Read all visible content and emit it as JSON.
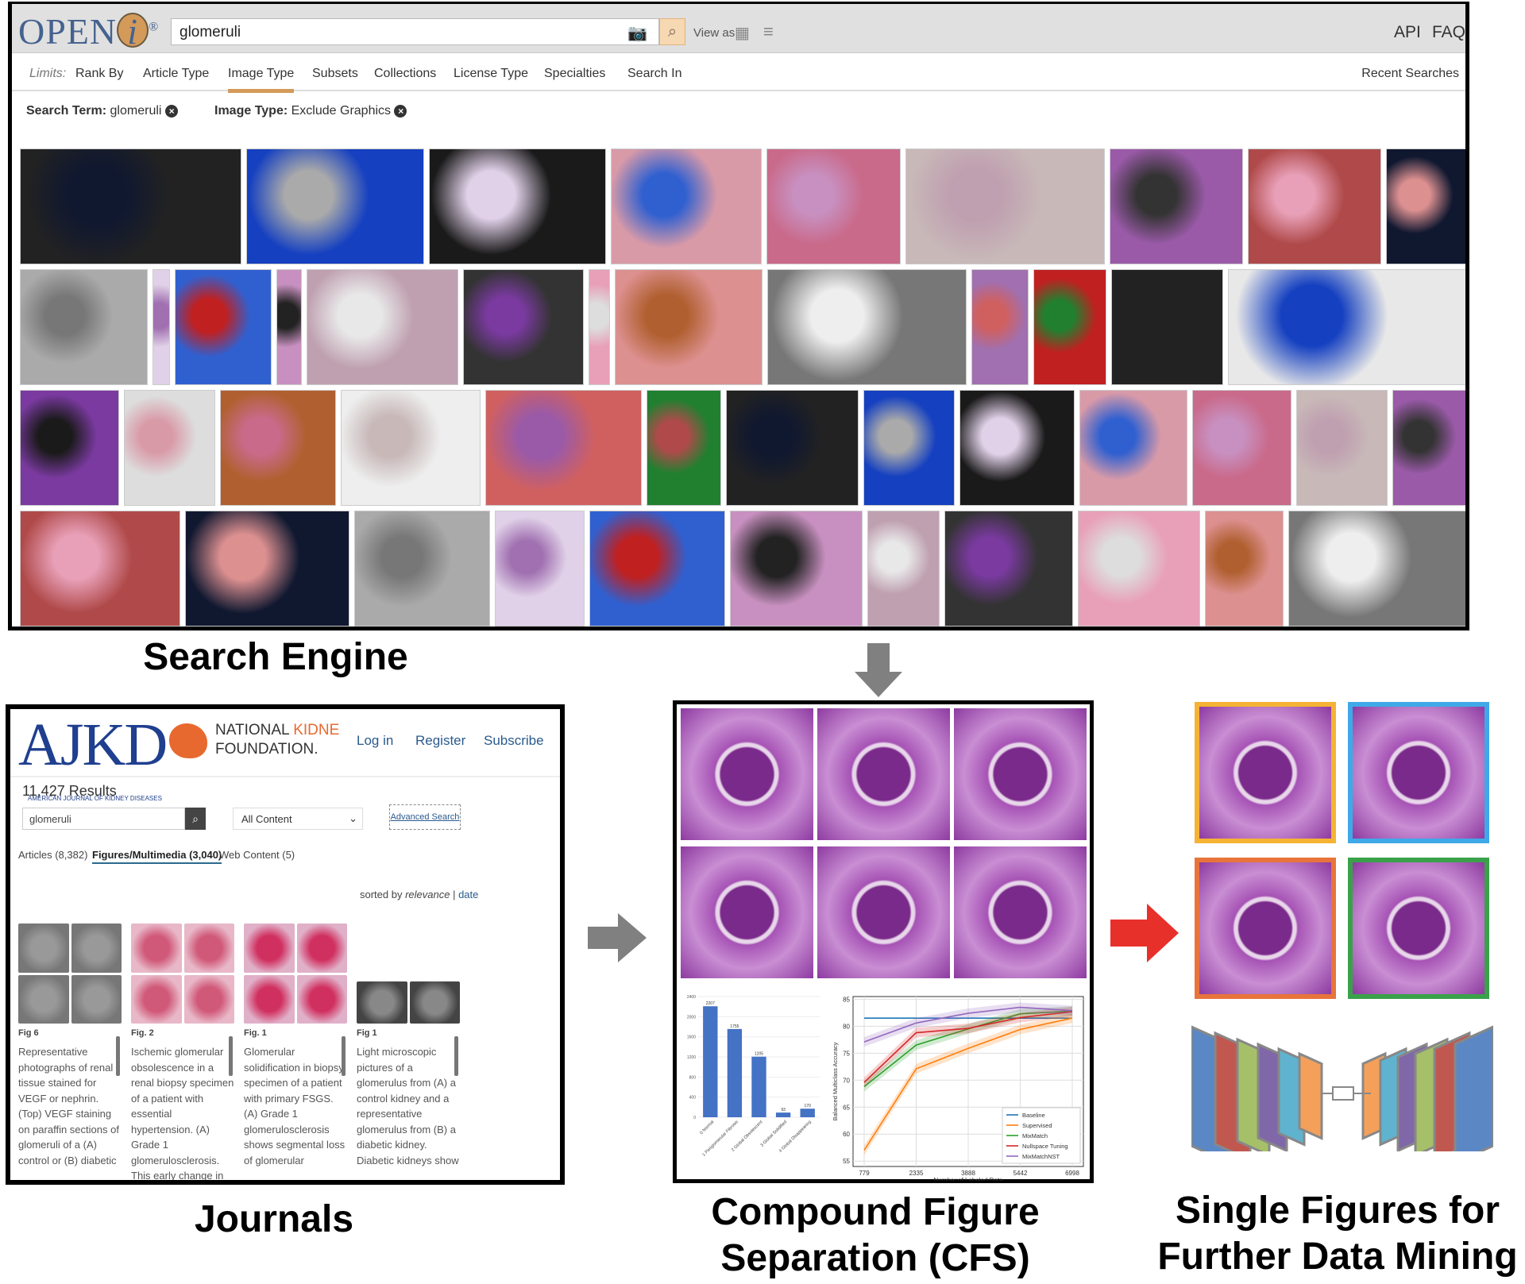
{
  "search_engine": {
    "logo": "OPENi",
    "logo_mark": "®",
    "search_value": "glomeruli",
    "camera_icon": "camera-icon",
    "search_icon": "search-icon",
    "view_as_label": "View as",
    "api_link": "API",
    "faq_link": "FAQ",
    "limits_label": "Limits:",
    "nav": [
      "Rank By",
      "Article Type",
      "Image Type",
      "Subsets",
      "Collections",
      "License Type",
      "Specialties",
      "Search In"
    ],
    "active_nav": "Image Type",
    "recent_searches": "Recent Searches",
    "filters": [
      {
        "key": "Search Term:",
        "value": "glomeruli"
      },
      {
        "key": "Image Type:",
        "value": "Exclude Graphics"
      }
    ],
    "accent_color": "#d49a5a",
    "thumbnail_colors": [
      "#222",
      "#1540c0",
      "#1a1a1a",
      "#d99aa8",
      "#c96a8a",
      "#c8b8b8",
      "#9a5aa8",
      "#b04a4a",
      "#101830",
      "#aaa",
      "#e0d0e8",
      "#3060d0",
      "#c890c0",
      "#bfa0b0",
      "#333",
      "#e8a0b8",
      "#dd9090",
      "#777",
      "#a070b0",
      "#c02020",
      "#222",
      "#e8e8e8",
      "#7a3aa0",
      "#ddd",
      "#b06030",
      "#eee",
      "#d06060",
      "#208030"
    ]
  },
  "labels": {
    "search_engine": "Search Engine",
    "journals": "Journals",
    "cfs_line1": "Compound Figure",
    "cfs_line2": "Separation (CFS)",
    "single_line1": "Single Figures for",
    "single_line2": "Further Data Mining"
  },
  "journal": {
    "logo": "AJKD",
    "logo_sub": "AMERICAN JOURNAL OF KIDNEY DISEASES",
    "nkf_line1a": "NATIONAL ",
    "nkf_line1b": "KIDNE",
    "nkf_line2": "FOUNDATION.",
    "links": [
      "Log in",
      "Register",
      "Subscribe"
    ],
    "results": "11,427 Results",
    "search_value": "glomeruli",
    "content_select": "All Content",
    "advanced_search": "Advanced Search",
    "tabs": [
      "Articles (8,382)",
      "Figures/Multimedia (3,040)",
      "Web Content (5)"
    ],
    "active_tab": "Figures/Multimedia (3,040)",
    "sort_prefix": "sorted by ",
    "sort_relevance": "relevance",
    "sort_sep": " | ",
    "sort_date": "date",
    "figures": [
      {
        "label": "Fig 6",
        "text": "Representative photographs of renal tissue stained for VEGF or nephrin. (Top) VEGF staining on paraffin sections of glomeruli of a (A) control or (B) diabetic"
      },
      {
        "label": "Fig. 2",
        "text": "Ischemic glomerular obsolescence in a renal biopsy specimen of a patient with essential hypertension. (A) Grade 1 glomerulosclerosis. This early change in"
      },
      {
        "label": "Fig. 1",
        "text": "Glomerular solidification in biopsy specimen of a patient with primary FSGS. (A) Grade 1 glomerulosclerosis shows segmental loss of glomerular"
      },
      {
        "label": "Fig 1",
        "text": "Light microscopic pictures of a glomerulus from (A) a control kidney and a representative glomerulus from (B) a diabetic kidney. Diabetic kidneys show"
      }
    ]
  },
  "chart_data": [
    {
      "type": "bar",
      "categories": [
        "0 Normal",
        "1 Periglomerular Fibrosis",
        "2 Global Obsolescent",
        "3 Global Solidified",
        "4 Global Disappearing"
      ],
      "values": [
        2207,
        1755,
        1205,
        93,
        170
      ],
      "ylim": [
        0,
        2400
      ],
      "yticks": [
        0,
        400,
        800,
        1200,
        1600,
        2000,
        2400
      ],
      "color": "#4472c4",
      "grid": true
    },
    {
      "type": "line",
      "xlabel": "Number of Labeled Data",
      "ylabel": "Balanced Multiclass Accuracy",
      "x": [
        779,
        2335,
        3888,
        5442,
        6998
      ],
      "ylim": [
        54,
        85.5
      ],
      "yticks": [
        55,
        60,
        65,
        70,
        75,
        80,
        85
      ],
      "grid": true,
      "legend": "bottom-right",
      "series": [
        {
          "name": "Baseline",
          "color": "#1f77b4",
          "values": [
            81.5,
            81.5,
            81.5,
            81.5,
            81.5
          ]
        },
        {
          "name": "Supervised",
          "color": "#ff7f0e",
          "values": [
            57.0,
            72.1,
            75.9,
            79.4,
            81.5
          ]
        },
        {
          "name": "MixMatch",
          "color": "#2ca02c",
          "values": [
            68.8,
            76.5,
            79.5,
            82.3,
            82.8
          ]
        },
        {
          "name": "Nullspace Tuning",
          "color": "#d62728",
          "values": [
            69.6,
            78.8,
            79.6,
            81.6,
            82.7
          ]
        },
        {
          "name": "MixMatchNST",
          "color": "#9467bd",
          "values": [
            77.1,
            80.6,
            82.4,
            83.5,
            82.9
          ]
        }
      ]
    }
  ],
  "single_figure_borders": [
    "#f5b335",
    "#3fa9e8",
    "#e8743b",
    "#3aa14a"
  ],
  "network_layer_colors": [
    "#5b87c5",
    "#c0584f",
    "#a6c06a",
    "#8068a8",
    "#5fb3cf",
    "#f4a05a"
  ],
  "arrow_colors": {
    "gray": "#808080",
    "red": "#e8302a"
  }
}
